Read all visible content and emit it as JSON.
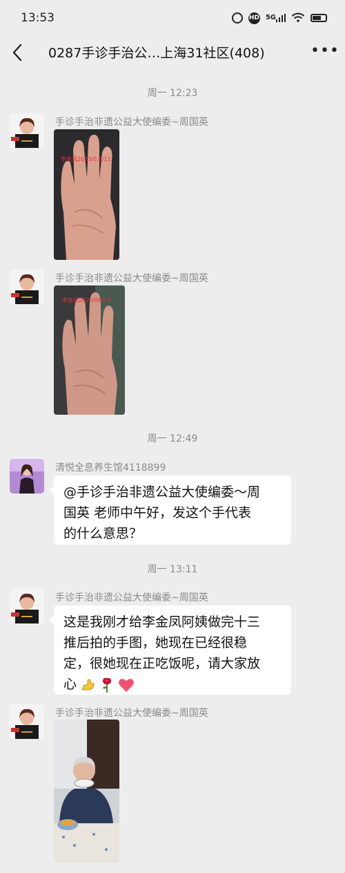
{
  "status_bar": {
    "time": "13:53",
    "hd_label": "HD",
    "network_label": "5G",
    "icons": [
      "alarm-icon",
      "hd-icon",
      "signal-5g-icon",
      "wifi-icon",
      "battery-icon"
    ]
  },
  "header": {
    "back_icon": "chevron-left-icon",
    "title": "0287手诊手治公…上海31社区(408)",
    "more_icon": "more-dots-icon",
    "more_label": "•••"
  },
  "time_separators": [
    "周一  12:23",
    "周一  12:49",
    "周一  13:11"
  ],
  "messages": [
    {
      "sender": "手诊手治非遗公益大使编委~周国英",
      "type": "image",
      "image_caption": "李金凤2023/0.8/11",
      "image_desc": "hand-palm-photo"
    },
    {
      "sender": "手诊手治非遗公益大使编委~周国英",
      "type": "image",
      "image_caption": "李金凤2023/08/13",
      "image_desc": "hand-palm-photo"
    },
    {
      "sender": "清悦全息养生馆4118899",
      "type": "text",
      "lines": [
        "@手诊手治非遗公益大使编委～周",
        "国英  老师中午好，发这个手代表",
        "的什么意思？"
      ]
    },
    {
      "sender": "手诊手治非遗公益大使编委~周国英",
      "type": "text",
      "lines": [
        "这是我刚才给李金凤阿姨做完十三",
        "推后拍的手图，她现在已经很稳",
        "定，很她现在正吃饭呢，请大家放",
        "心"
      ],
      "emoji": [
        "strong-arm-icon",
        "rose-icon",
        "heart-icon"
      ]
    },
    {
      "sender": "手诊手治非遗公益大使编委~周国英",
      "type": "image",
      "image_desc": "elderly-woman-eating-photo"
    }
  ],
  "colors": {
    "background": "#ededed",
    "bubble": "#ffffff",
    "meta_text": "#8a8a8a",
    "heart": "#f0506e",
    "rose": "#c8102e"
  }
}
